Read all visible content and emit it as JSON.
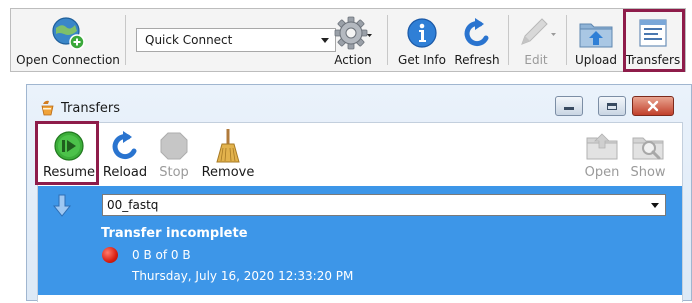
{
  "toolbar": {
    "open_connection": "Open Connection",
    "quick_connect": "Quick Connect",
    "action": "Action",
    "get_info": "Get Info",
    "refresh": "Refresh",
    "edit": "Edit",
    "upload": "Upload",
    "transfers": "Transfers"
  },
  "transfers_window": {
    "title": "Transfers",
    "toolbar": {
      "resume": "Resume",
      "reload": "Reload",
      "stop": "Stop",
      "remove": "Remove",
      "open": "Open",
      "show": "Show"
    },
    "transfer": {
      "file": "00_fastq",
      "status": "Transfer incomplete",
      "progress": "0 B of 0 B",
      "timestamp": "Thursday, July 16, 2020 12:33:20 PM"
    }
  },
  "colors": {
    "highlight": "#8e1c4a",
    "selection": "#3d96e8",
    "window_border": "#a0b6d0"
  },
  "icons": {
    "open_connection": "globe-plus-icon",
    "action": "gear-icon",
    "get_info": "info-icon",
    "refresh": "refresh-icon",
    "edit": "pencil-icon",
    "upload": "folder-upload-icon",
    "transfers": "transfers-list-icon",
    "resume": "play-icon",
    "reload": "reload-icon",
    "stop": "stop-icon",
    "remove": "broom-icon",
    "open": "folder-open-icon",
    "show": "magnifier-icon",
    "direction": "download-arrow-icon",
    "status": "red-dot-icon",
    "window": "transfers-app-icon"
  }
}
